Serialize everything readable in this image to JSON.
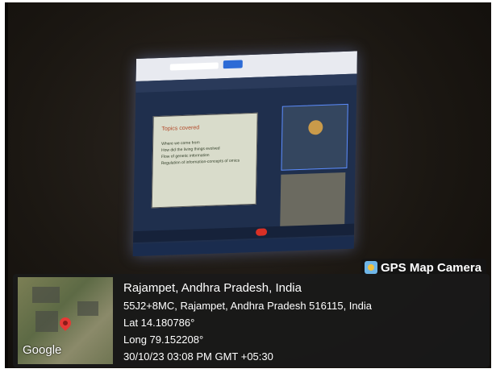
{
  "overlay": {
    "app_name": "GPS Map Camera",
    "location_title": "Rajampet, Andhra Pradesh, India",
    "address": "55J2+8MC, Rajampet, Andhra Pradesh 516115, India",
    "latitude": "Lat 14.180786°",
    "longitude": "Long 79.152208°",
    "datetime": "30/10/23 03:08 PM GMT +05:30",
    "map_brand": "Google"
  },
  "slide": {
    "title": "Topics covered",
    "bullets": [
      "Where we come from",
      "How did the living things evolved",
      "Flow of genetic information",
      "Regulation of information-concepts of omics"
    ]
  }
}
